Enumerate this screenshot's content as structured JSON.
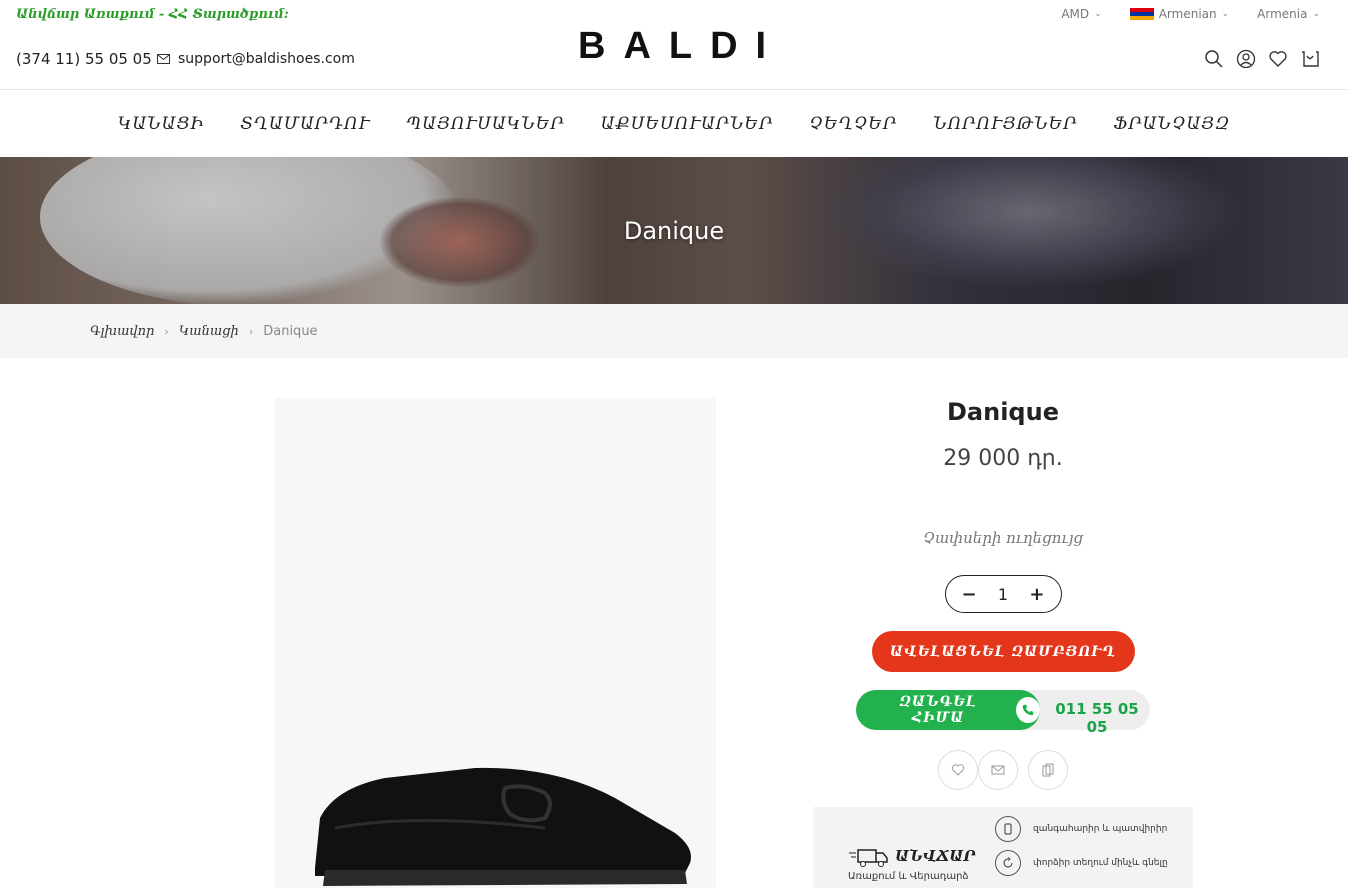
{
  "header": {
    "promo": "Անվճար Առաքում - ՀՀ Տարածքում:",
    "phone": "(374 11) 55 05 05",
    "email": "support@baldishoes.com",
    "logo": "BALDI",
    "currency": "AMD",
    "language": "Armenian",
    "country": "Armenia"
  },
  "nav": {
    "items": [
      "ԿԱՆԱՑԻ",
      "ՏՂԱՄԱՐԴՈՒ",
      "ՊԱՅՈՒՍԱԿՆԵՐ",
      "ԱՔՍԵՍՈՒԱՐՆԵՐ",
      "ՉԵՂՉԵՐ",
      "ՆՈՐՈՒՅԹՆԵՐ",
      "ՖՐԱՆՉԱՅԶ"
    ]
  },
  "hero": {
    "title": "Danique"
  },
  "breadcrumb": {
    "home": "Գլխավոր",
    "category": "Կանացի",
    "current": "Danique"
  },
  "product": {
    "name": "Danique",
    "price": "29 000 դր.",
    "size_guide": "Չափսերի ուղեցույց",
    "quantity": "1",
    "minus": "−",
    "plus": "+",
    "add_to_cart": "ԱՎԵԼԱՑՆԵԼ ԶԱՄԲՅՈՒՂ",
    "call_now": "ԶԱՆԳԵԼ ՀԻՄԱ",
    "call_number": "011 55 05 05"
  },
  "promo_box": {
    "free": "ԱՆՎՃԱՐ",
    "sub": "Առաքում և Վերադարձ",
    "features": [
      "զանգահարիր և պատվիրիր",
      "փորձիր տեղում մինչև գնելը"
    ]
  },
  "colors": {
    "accent_red": "#e3361b",
    "call_green": "#22b14c",
    "promo_green": "#2a9d2a"
  }
}
